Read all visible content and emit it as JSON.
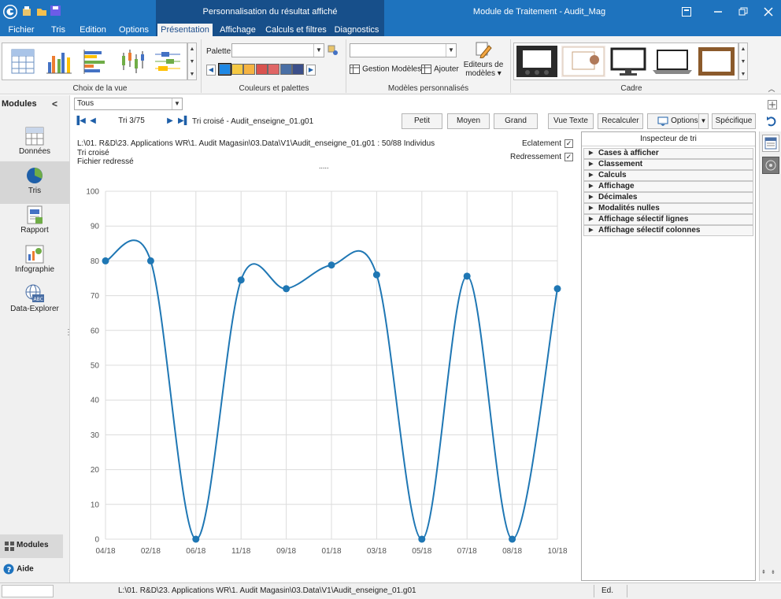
{
  "window": {
    "context_title": "Personnalisation du résultat affiché",
    "app_title": "Module de Traitement - Audit_Mag"
  },
  "ribbon_tabs": [
    "Fichier",
    "Tris",
    "Edition",
    "Options",
    "Présentation",
    "Affichage",
    "Calculs et filtres",
    "Diagnostics"
  ],
  "ribbon": {
    "view_group_label": "Choix de la vue",
    "palette_label": "Palette",
    "colors_group_label": "Couleurs et palettes",
    "gestion_modeles": "Gestion Modèles",
    "ajouter": "Ajouter",
    "editeurs_line1": "Editeurs de",
    "editeurs_line2": "modèles ▾",
    "models_group_label": "Modèles personnalisés",
    "cadre_group_label": "Cadre",
    "swatch_colors": [
      "#1e88e5",
      "#f5c842",
      "#f5b342",
      "#d9534f",
      "#e06666",
      "#4a6fa5",
      "#3b4f8a"
    ]
  },
  "leftnav": {
    "title": "Modules",
    "items": [
      "Données",
      "Tris",
      "Rapport",
      "Infographie",
      "Data-Explorer"
    ],
    "footer_modules": "Modules",
    "footer_help": "Aide"
  },
  "toolbar": {
    "filter_value": "Tous",
    "tri_counter": "Tri 3/75",
    "tri_title": "Tri croisé - Audit_enseigne_01.g01",
    "buttons": [
      "Petit",
      "Moyen",
      "Grand",
      "Vue Texte",
      "Recalculer",
      "Options",
      "Spécifique"
    ]
  },
  "info": {
    "path_line": "L:\\01. R&D\\23. Applications WR\\1. Audit Magasin\\03.Data\\V1\\Audit_enseigne_01.g01 : 50/88 Individus",
    "type_line": "Tri croisé",
    "fichier_line": "Fichier redressé",
    "eclatement_label": "Eclatement",
    "redressement_label": "Redressement",
    "dots": "....."
  },
  "chart_data": {
    "type": "line",
    "categories": [
      "04/18",
      "02/18",
      "06/18",
      "11/18",
      "09/18",
      "01/18",
      "03/18",
      "05/18",
      "07/18",
      "08/18",
      "10/18"
    ],
    "values": [
      80,
      80,
      0,
      74.5,
      72,
      78.8,
      76,
      0,
      75.6,
      0,
      72
    ],
    "ylim": [
      0,
      100
    ],
    "yticks": [
      0,
      10,
      20,
      30,
      40,
      50,
      60,
      70,
      80,
      90,
      100
    ],
    "grid": true,
    "smooth": true,
    "series_color": "#1f77b4"
  },
  "inspector": {
    "title": "Inspecteur de tri",
    "sections": [
      "Cases à afficher",
      "Classement",
      "Calculs",
      "Affichage",
      "Décimales",
      "Modalités nulles",
      "Affichage sélectif lignes",
      "Affichage sélectif colonnes"
    ]
  },
  "statusbar": {
    "path": "L:\\01. R&D\\23. Applications WR\\1. Audit Magasin\\03.Data\\V1\\Audit_enseigne_01.g01",
    "mode": "Ed."
  }
}
